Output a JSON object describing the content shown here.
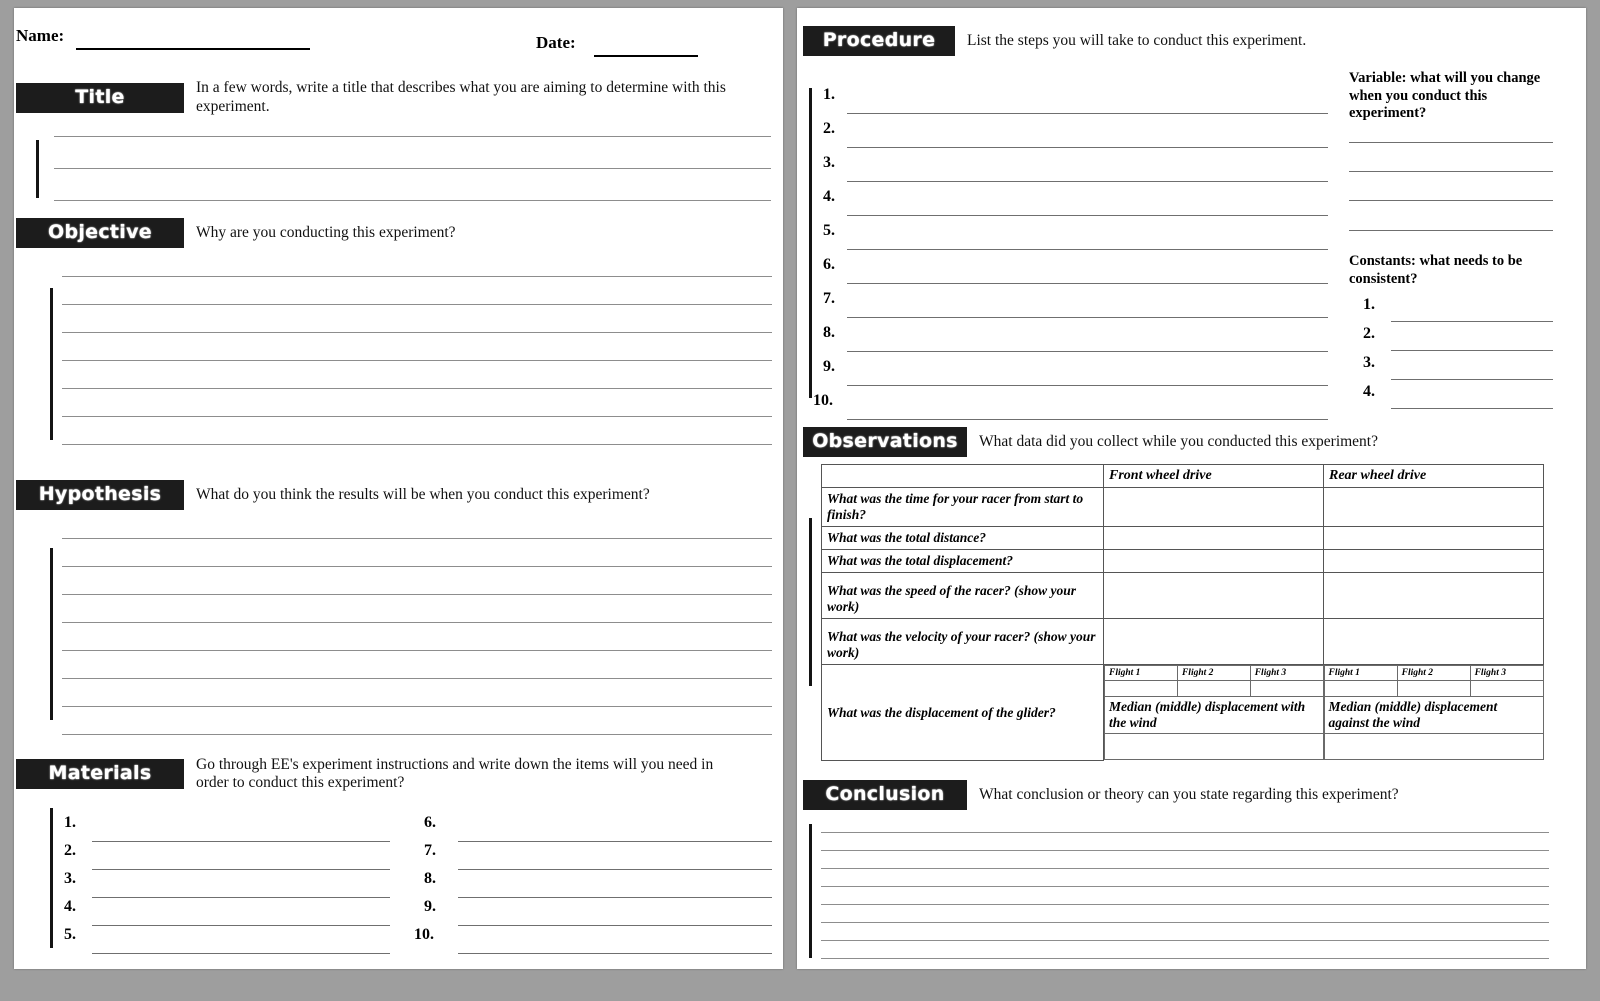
{
  "header": {
    "name_label": "Name:",
    "date_label": "Date:"
  },
  "left_page": {
    "title": {
      "label": "Title",
      "prompt": "In a few words, write a title that describes what you are aiming to determine with this experiment.",
      "line_count": 3
    },
    "objective": {
      "label": "Objective",
      "prompt": "Why are you conducting this experiment?",
      "line_count": 7
    },
    "hypothesis": {
      "label": "Hypothesis",
      "prompt": "What do you think the results will be when you conduct this experiment?",
      "line_count": 8
    },
    "materials": {
      "label": "Materials",
      "prompt": "Go through EE's experiment instructions and write down the items will you need in order to conduct this experiment?",
      "left_numbers": [
        "1.",
        "2.",
        "3.",
        "4.",
        "5."
      ],
      "right_numbers": [
        "6.",
        "7.",
        "8.",
        "9.",
        "10."
      ]
    }
  },
  "right_page": {
    "procedure": {
      "label": "Procedure",
      "prompt": "List the steps you will take to conduct this experiment.",
      "numbers": [
        "1.",
        "2.",
        "3.",
        "4.",
        "5.",
        "6.",
        "7.",
        "8.",
        "9.",
        "10."
      ]
    },
    "variable": {
      "question": "Variable: what will you change when you conduct this experiment?",
      "blank_line_count": 4
    },
    "constants": {
      "question": "Constants: what needs to be consistent?",
      "numbers": [
        "1.",
        "2.",
        "3.",
        "4."
      ]
    },
    "observations": {
      "label": "Observations",
      "prompt": "What data did you collect while you conducted this experiment?",
      "columns": [
        "",
        "Front wheel drive",
        "Rear wheel drive"
      ],
      "rows": [
        "What was the time for your racer from start to finish?",
        "What was the total distance?",
        "What was the total displacement?",
        "What was the speed of the racer? (show your work)",
        "What was the velocity of your racer? (show your work)"
      ],
      "glider_row": {
        "question": "What was the displacement of the glider?",
        "flight_headers": [
          "Flight 1",
          "Flight 2",
          "Flight 3"
        ],
        "median_with_wind": "Median (middle) displacement with the wind",
        "median_against_wind": "Median (middle) displacement against the wind"
      }
    },
    "conclusion": {
      "label": "Conclusion",
      "prompt": "What conclusion or theory can you state regarding this experiment?",
      "line_count": 8
    }
  }
}
